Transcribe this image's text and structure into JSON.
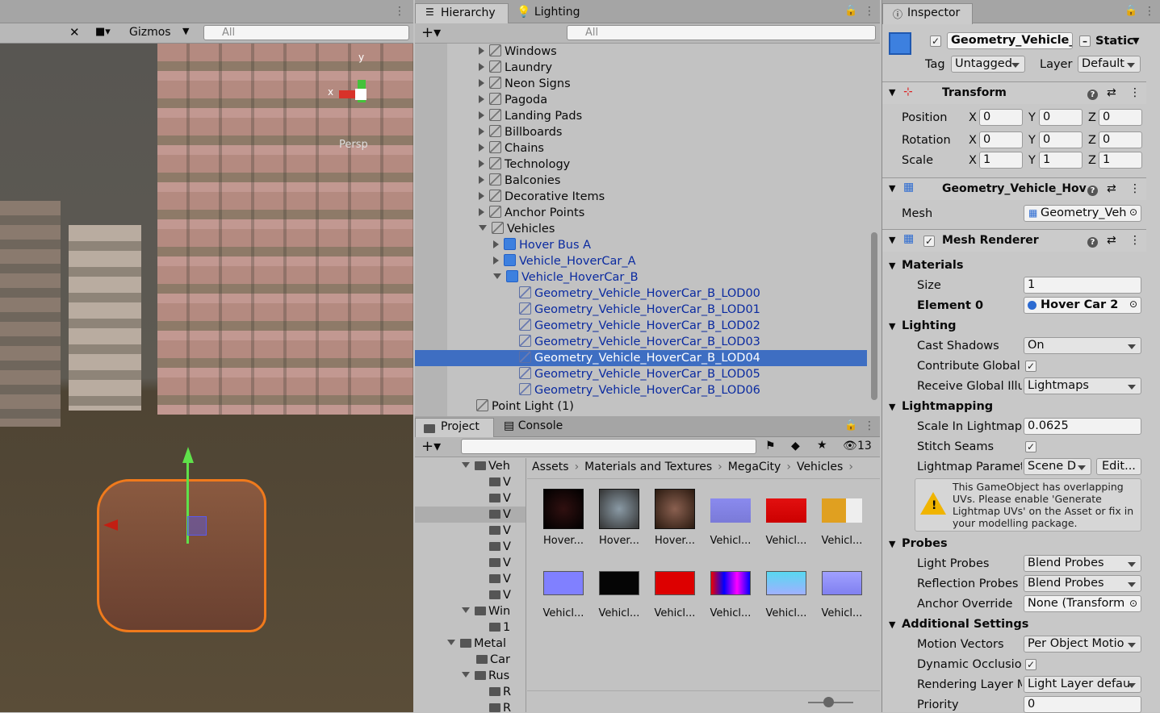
{
  "scene": {
    "gizmos_label": "Gizmos",
    "search_placeholder": "All",
    "persp_label": "Persp",
    "axis_x": "x",
    "axis_y": "y"
  },
  "hierarchy": {
    "tab_label": "Hierarchy",
    "lighting_tab": "Lighting",
    "search_placeholder": "All",
    "items": [
      "Windows",
      "Laundry",
      "Neon Signs",
      "Pagoda",
      "Landing Pads",
      "Billboards",
      "Chains",
      "Technology",
      "Balconies",
      "Decorative Items",
      "Anchor Points",
      "Vehicles"
    ],
    "vehicles": [
      "Hover Bus A",
      "Vehicle_HoverCar_A",
      "Vehicle_HoverCar_B"
    ],
    "lods": [
      "Geometry_Vehicle_HoverCar_B_LOD00",
      "Geometry_Vehicle_HoverCar_B_LOD01",
      "Geometry_Vehicle_HoverCar_B_LOD02",
      "Geometry_Vehicle_HoverCar_B_LOD03",
      "Geometry_Vehicle_HoverCar_B_LOD04",
      "Geometry_Vehicle_HoverCar_B_LOD05",
      "Geometry_Vehicle_HoverCar_B_LOD06"
    ],
    "point_light": "Point Light (1)"
  },
  "project": {
    "tab_label": "Project",
    "console_tab": "Console",
    "hidden_count": "13",
    "breadcrumb": [
      "Assets",
      "Materials and Textures",
      "MegaCity",
      "Vehicles"
    ],
    "tree": [
      "Veh",
      "V",
      "V",
      "V",
      "V",
      "V",
      "V",
      "V",
      "V",
      "Win",
      "1",
      "Metal",
      "Car",
      "Rus",
      "R",
      "R"
    ],
    "assets_row1": [
      "Hover...",
      "Hover...",
      "Hover...",
      "Vehicl...",
      "Vehicl...",
      "Vehicl..."
    ],
    "assets_row2": [
      "Vehicl...",
      "Vehicl...",
      "Vehicl...",
      "Vehicl...",
      "Vehicl...",
      "Vehicl..."
    ]
  },
  "inspector": {
    "tab_label": "Inspector",
    "object_name": "Geometry_Vehicle_H",
    "static_label": "Static",
    "tag_label": "Tag",
    "tag_value": "Untagged",
    "layer_label": "Layer",
    "layer_value": "Default",
    "transform": {
      "title": "Transform",
      "position_label": "Position",
      "rotation_label": "Rotation",
      "scale_label": "Scale",
      "px": "0",
      "py": "0",
      "pz": "0",
      "rx": "0",
      "ry": "0",
      "rz": "0",
      "sx": "1",
      "sy": "1",
      "sz": "1"
    },
    "mesh_filter": {
      "title": "Geometry_Vehicle_Hov",
      "mesh_label": "Mesh",
      "mesh_value": "Geometry_Veh"
    },
    "mesh_renderer": {
      "title": "Mesh Renderer",
      "materials": "Materials",
      "size_label": "Size",
      "size_value": "1",
      "element0_label": "Element 0",
      "element0_value": "Hover Car 2",
      "lighting": "Lighting",
      "cast_shadows_label": "Cast Shadows",
      "cast_shadows_value": "On",
      "contribute_gi_label": "Contribute Global",
      "receive_gi_label": "Receive Global Illu",
      "receive_gi_value": "Lightmaps",
      "lightmapping": "Lightmapping",
      "scale_lm_label": "Scale In Lightmap",
      "scale_lm_value": "0.0625",
      "stitch_label": "Stitch Seams",
      "lm_params_label": "Lightmap Paramet",
      "lm_params_value": "Scene D",
      "edit_label": "Edit...",
      "warning": "This GameObject has overlapping UVs. Please enable 'Generate Lightmap UVs' on the Asset or fix in your modelling package.",
      "probes": "Probes",
      "light_probes_label": "Light Probes",
      "light_probes_value": "Blend Probes",
      "refl_probes_label": "Reflection Probes",
      "refl_probes_value": "Blend Probes",
      "anchor_label": "Anchor Override",
      "anchor_value": "None (Transform",
      "additional": "Additional Settings",
      "motion_label": "Motion Vectors",
      "motion_value": "Per Object Motio",
      "dynamic_label": "Dynamic Occlusio",
      "rendering_layer_label": "Rendering Layer M",
      "rendering_layer_value": "Light Layer defau",
      "priority_label": "Priority",
      "priority_value": "0"
    }
  }
}
